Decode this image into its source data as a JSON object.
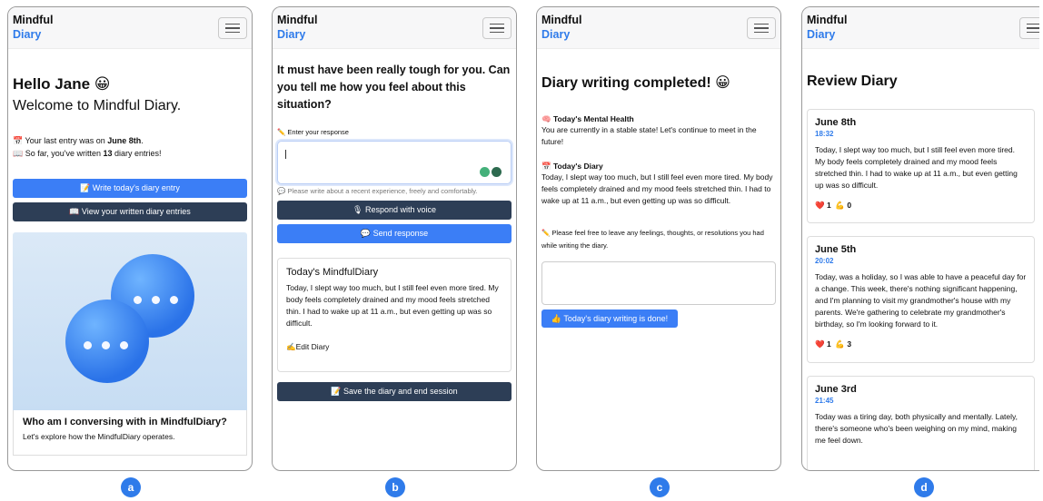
{
  "common": {
    "brand_line1": "Mindful",
    "brand_line2": "Diary"
  },
  "panel_labels": [
    "a",
    "b",
    "c",
    "d"
  ],
  "panel_a": {
    "greeting": "Hello Jane 😀",
    "welcome": "Welcome to Mindful Diary.",
    "last_entry_prefix": "📅 Your last entry was on ",
    "last_entry_date": "June 8th",
    "last_entry_suffix": ".",
    "count_prefix": "📖 So far, you've written ",
    "count_value": "13",
    "count_suffix": " diary entries!",
    "write_button": "📝 Write today's diary entry",
    "view_button": "📖 View your written diary entries",
    "card_title": "Who am I conversing with in MindfulDiary?",
    "card_subtitle": "Let's explore how the MindfulDiary operates."
  },
  "panel_b": {
    "question": "It must have been really tough for you. Can you tell me how you feel about this situation?",
    "input_label": "✏️ Enter your response",
    "hint": "💬 Please write about a recent experience, freely and comfortably.",
    "voice_button": "🎙 Respond with voice",
    "send_button": "💬 Send response",
    "diary_title": "Today's MindfulDiary",
    "diary_body": "Today, I slept way too much, but I still feel even more tired. My body feels completely drained and my mood feels stretched thin. I had to wake up at 11 a.m., but even getting up was so difficult.",
    "edit_label": "✍️Edit Diary",
    "save_button": "📝 Save the diary and end session"
  },
  "panel_c": {
    "title": "Diary writing completed! 😀",
    "mental_label": "🧠 Today's Mental Health",
    "mental_text": "You are currently in a stable state! Let's continue to meet in the future!",
    "diary_label": "📅 Today's Diary",
    "diary_text": "Today, I slept way too much, but I still feel even more tired. My body feels completely drained and my mood feels stretched thin. I had to wake up at 11 a.m., but even getting up was so difficult.",
    "prompt": "✏️ Please feel free to leave any feelings, thoughts, or resolutions you had while writing the diary.",
    "done_button": "👍 Today's diary writing is done!"
  },
  "panel_d": {
    "title": "Review Diary",
    "entries": [
      {
        "date": "June 8th",
        "time": "18:32",
        "body": "Today, I slept way too much, but I still feel even more tired. My body feels completely drained and my mood feels stretched thin. I had to wake up at 11 a.m., but even getting up was so difficult.",
        "hearts": "❤️ 1",
        "strong": "💪 0"
      },
      {
        "date": "June 5th",
        "time": "20:02",
        "body": "Today, was a holiday, so I was able to have a peaceful day for a change. This week, there's nothing significant happening, and I'm planning to visit my grandmother's house with my parents. We're gathering to celebrate my grandmother's birthday, so I'm looking forward to it.",
        "hearts": "❤️ 1",
        "strong": "💪 3"
      },
      {
        "date": "June 3rd",
        "time": "21:45",
        "body": "Today was a tiring day, both physically and mentally. Lately, there's someone who's been weighing on my mind, making me feel down."
      }
    ]
  }
}
